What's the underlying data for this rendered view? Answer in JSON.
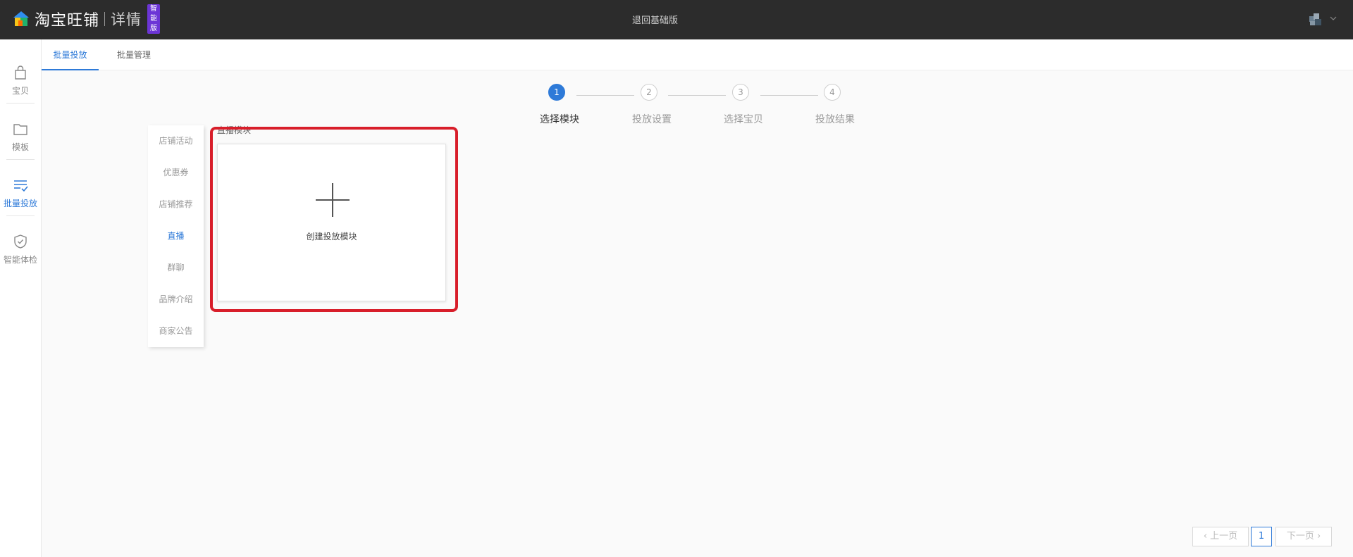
{
  "header": {
    "brand_name": "淘宝旺铺",
    "brand_sub": "详情",
    "badge": "智能版",
    "center_link": "退回基础版",
    "colors": {
      "bar": "#2c2c2c",
      "badge": "#6c35d6"
    }
  },
  "left_nav": {
    "items": [
      {
        "label": "宝贝",
        "icon": "bag-icon"
      },
      {
        "label": "模板",
        "icon": "folder-icon"
      },
      {
        "label": "批量投放",
        "icon": "list-check-icon",
        "active": true
      },
      {
        "label": "智能体检",
        "icon": "shield-check-icon"
      }
    ]
  },
  "tabs": [
    {
      "label": "批量投放",
      "active": true
    },
    {
      "label": "批量管理"
    }
  ],
  "steps": [
    {
      "num": "1",
      "label": "选择模块",
      "active": true
    },
    {
      "num": "2",
      "label": "投放设置"
    },
    {
      "num": "3",
      "label": "选择宝贝"
    },
    {
      "num": "4",
      "label": "投放结果"
    }
  ],
  "categories": [
    {
      "label": "店铺活动"
    },
    {
      "label": "优惠券"
    },
    {
      "label": "店铺推荐"
    },
    {
      "label": "直播",
      "active": true
    },
    {
      "label": "群聊"
    },
    {
      "label": "品牌介绍"
    },
    {
      "label": "商家公告"
    }
  ],
  "module": {
    "title": "直播模块",
    "create_label": "创建投放模块",
    "create_icon": "plus-icon"
  },
  "pagination": {
    "prev": "上一页",
    "current": "1",
    "next": "下一页"
  },
  "accent_color": "#2e7ad8",
  "highlight_color": "#d81e2a"
}
